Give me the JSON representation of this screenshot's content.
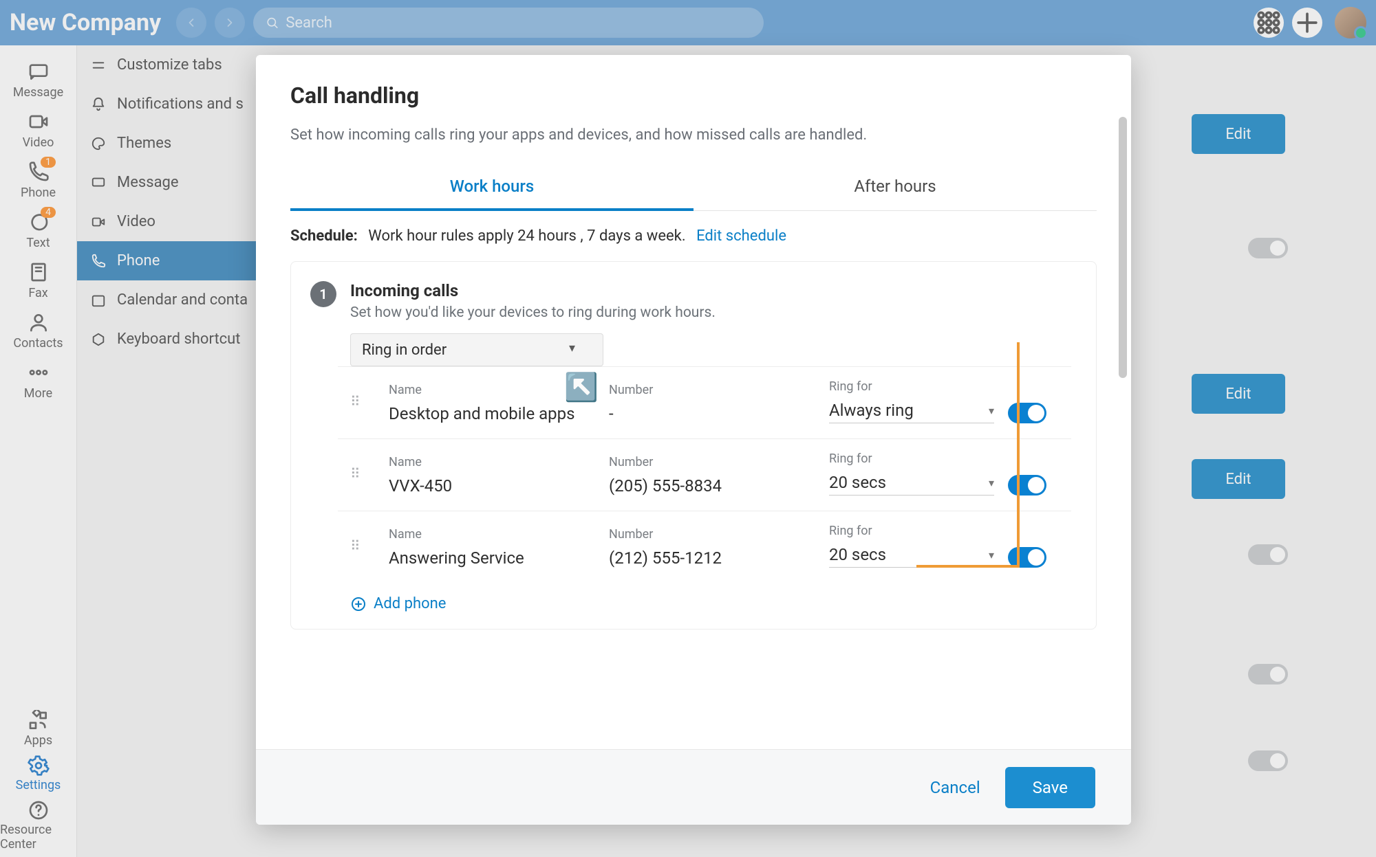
{
  "topbar": {
    "company": "New Company",
    "search_placeholder": "Search"
  },
  "rail": {
    "items": [
      {
        "label": "Message",
        "icon": "message"
      },
      {
        "label": "Video",
        "icon": "video"
      },
      {
        "label": "Phone",
        "icon": "phone",
        "badge": "1"
      },
      {
        "label": "Text",
        "icon": "text",
        "badge": "4"
      },
      {
        "label": "Fax",
        "icon": "fax"
      },
      {
        "label": "Contacts",
        "icon": "contacts"
      },
      {
        "label": "More",
        "icon": "more"
      }
    ],
    "bottom": [
      {
        "label": "Apps",
        "icon": "apps"
      },
      {
        "label": "Settings",
        "icon": "settings",
        "active": true
      },
      {
        "label": "Resource Center",
        "icon": "help"
      }
    ]
  },
  "secondary": {
    "items": [
      {
        "label": "Customize tabs"
      },
      {
        "label": "Notifications and s"
      },
      {
        "label": "Themes"
      },
      {
        "label": "Message"
      },
      {
        "label": "Video"
      },
      {
        "label": "Phone",
        "active": true
      },
      {
        "label": "Calendar and conta"
      },
      {
        "label": "Keyboard shortcut"
      }
    ]
  },
  "background": {
    "edit_label": "Edit"
  },
  "modal": {
    "title": "Call handling",
    "description": "Set how incoming calls ring your apps and devices, and how missed calls are handled.",
    "tabs": {
      "work": "Work hours",
      "after": "After hours"
    },
    "schedule_label": "Schedule:",
    "schedule_text": "Work hour rules apply 24 hours , 7 days a week.",
    "schedule_link": "Edit schedule",
    "section": {
      "step": "1",
      "title": "Incoming calls",
      "subtitle": "Set how you'd like your devices to ring during work hours.",
      "ring_mode": "Ring in order",
      "columns": {
        "name": "Name",
        "number": "Number",
        "ringfor": "Ring for"
      },
      "rows": [
        {
          "name": "Desktop and mobile apps",
          "number": "-",
          "ringfor": "Always ring"
        },
        {
          "name": "VVX-450",
          "number": "(205) 555-8834",
          "ringfor": "20 secs"
        },
        {
          "name": "Answering Service",
          "number": "(212) 555-1212",
          "ringfor": "20 secs"
        }
      ],
      "add_phone": "Add phone"
    },
    "footer": {
      "cancel": "Cancel",
      "save": "Save"
    }
  }
}
